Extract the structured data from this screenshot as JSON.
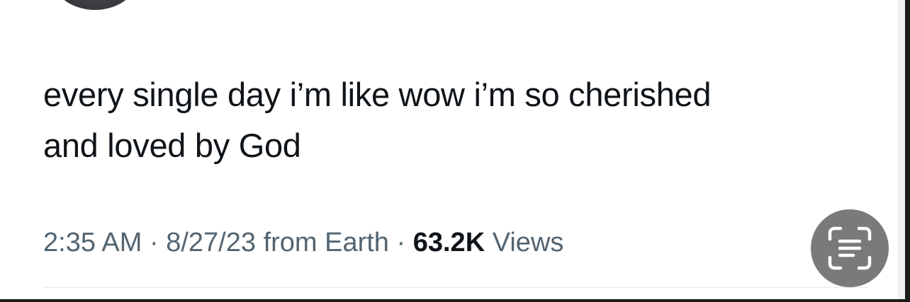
{
  "tweet": {
    "text_line1": "every single day i’m like wow i’m so cherished",
    "text_line2": "and loved by God",
    "time": "2:35 AM",
    "separator": "·",
    "date": "8/27/23",
    "source": "from Earth",
    "views_count": "63.2K",
    "views_label": "Views"
  },
  "icons": {
    "live_text": "live-text-icon",
    "avatar": "avatar"
  },
  "colors": {
    "text": "#0f1419",
    "meta": "#536471",
    "button": "#7a7a7a"
  }
}
